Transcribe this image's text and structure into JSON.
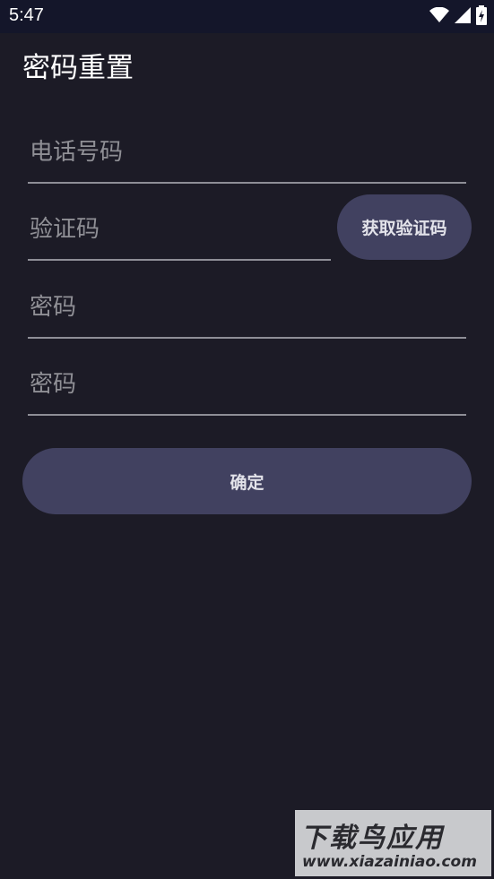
{
  "status_bar": {
    "time": "5:47",
    "icons": [
      "wifi-icon",
      "signal-icon",
      "battery-charging-icon"
    ]
  },
  "header": {
    "title": "密码重置"
  },
  "form": {
    "phone": {
      "placeholder": "电话号码",
      "value": ""
    },
    "code": {
      "placeholder": "验证码",
      "value": ""
    },
    "get_code_label": "获取验证码",
    "password": {
      "placeholder": "密码",
      "value": ""
    },
    "password_confirm": {
      "placeholder": "密码",
      "value": ""
    },
    "confirm_label": "确定"
  },
  "watermark": {
    "title": "下载鸟应用",
    "url": "www.xiazainiao.com"
  },
  "colors": {
    "background": "#1c1b26",
    "status_bar": "#14162a",
    "button": "#414160",
    "underline": "#8e8e96"
  }
}
